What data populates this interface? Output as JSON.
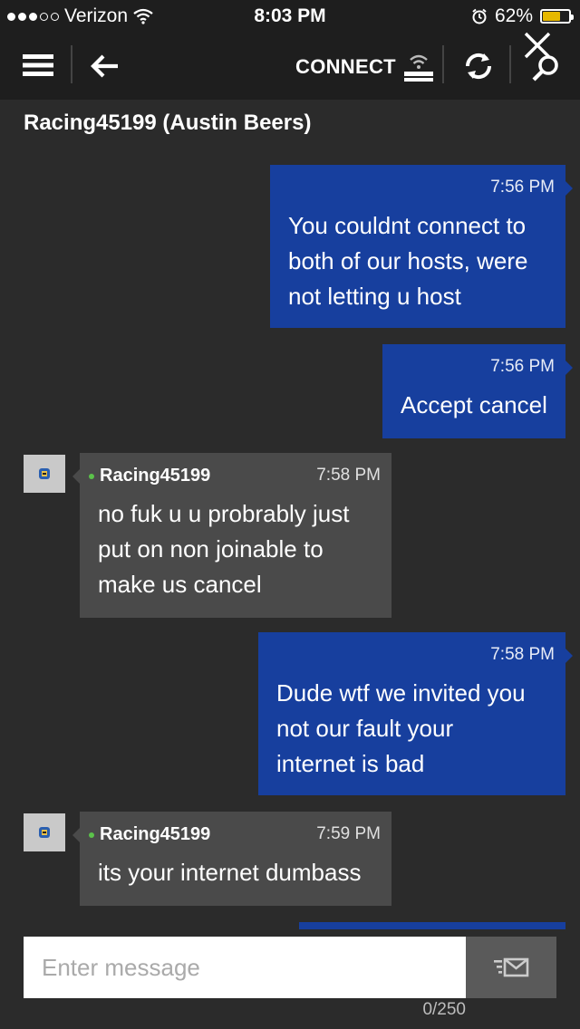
{
  "status_bar": {
    "carrier": "Verizon",
    "signal_dots_filled": 3,
    "signal_dots_total": 5,
    "time": "8:03 PM",
    "battery": "62%",
    "battery_level": 0.62,
    "battery_color": "#e6b800"
  },
  "toolbar": {
    "connect_label": "CONNECT",
    "icons": [
      "menu-icon",
      "back-arrow-icon",
      "console-wifi-icon",
      "refresh-icon",
      "search-icon",
      "close-icon"
    ]
  },
  "conversation": {
    "title": "Racing45199 (Austin Beers)"
  },
  "messages": [
    {
      "direction": "outgoing",
      "time": "7:56 PM",
      "lines": [
        "You couldnt connect to",
        "both of our hosts, were",
        "not letting u host"
      ]
    },
    {
      "direction": "outgoing",
      "time": "7:56 PM",
      "lines": [
        "Accept cancel"
      ]
    },
    {
      "direction": "incoming",
      "sender": "Racing45199",
      "time": "7:58 PM",
      "lines": [
        "no fuk u u probrably just",
        "put on non joinable to",
        "make us cancel"
      ]
    },
    {
      "direction": "outgoing",
      "time": "7:58 PM",
      "lines": [
        "Dude wtf we invited you",
        "not our fault your",
        "internet is bad"
      ]
    },
    {
      "direction": "incoming",
      "sender": "Racing45199",
      "time": "7:59 PM",
      "lines": [
        "its your internet dumbass"
      ]
    }
  ],
  "composer": {
    "placeholder": "Enter message",
    "value": "",
    "counter": "0/250"
  },
  "colors": {
    "background": "#2b2b2b",
    "bar": "#1e1e1e",
    "outgoing_bubble": "#173f9e",
    "incoming_bubble": "#4a4a4a",
    "presence_online": "#5bc24a"
  }
}
